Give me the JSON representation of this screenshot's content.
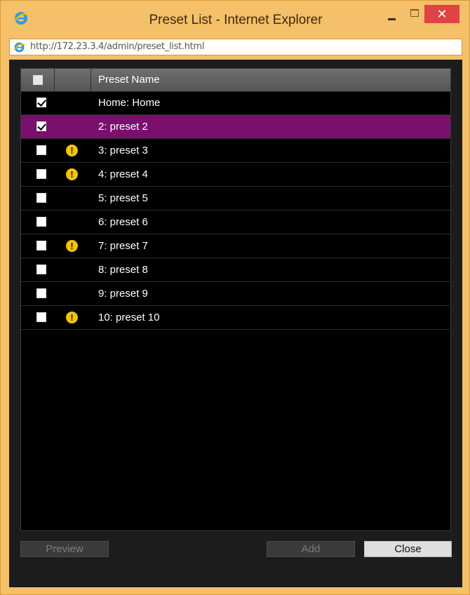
{
  "window": {
    "title": "Preset List - Internet Explorer",
    "close_glyph": "✕",
    "address": "http://172.23.3.4/admin/preset_list.html"
  },
  "list": {
    "column_header": "Preset Name",
    "rows": [
      {
        "name": "Home: Home",
        "checked": true,
        "warning": false
      },
      {
        "name": "2: preset 2",
        "checked": true,
        "warning": false,
        "selected": true
      },
      {
        "name": "3: preset 3",
        "checked": false,
        "warning": true
      },
      {
        "name": "4: preset 4",
        "checked": false,
        "warning": true
      },
      {
        "name": "5: preset 5",
        "checked": false,
        "warning": false
      },
      {
        "name": "6: preset 6",
        "checked": false,
        "warning": false
      },
      {
        "name": "7: preset 7",
        "checked": false,
        "warning": true
      },
      {
        "name": "8: preset 8",
        "checked": false,
        "warning": false
      },
      {
        "name": "9: preset 9",
        "checked": false,
        "warning": false
      },
      {
        "name": "10: preset 10",
        "checked": false,
        "warning": true
      }
    ]
  },
  "buttons": {
    "preview": "Preview",
    "add": "Add",
    "close": "Close"
  },
  "icons": {
    "app": "internet-explorer-icon",
    "warning": "warning-icon",
    "warning_glyph": "!"
  },
  "colors": {
    "frame": "#f4c069",
    "selected_row": "#7a0f6e",
    "warning": "#f2c20f",
    "close_control": "#e04343"
  }
}
